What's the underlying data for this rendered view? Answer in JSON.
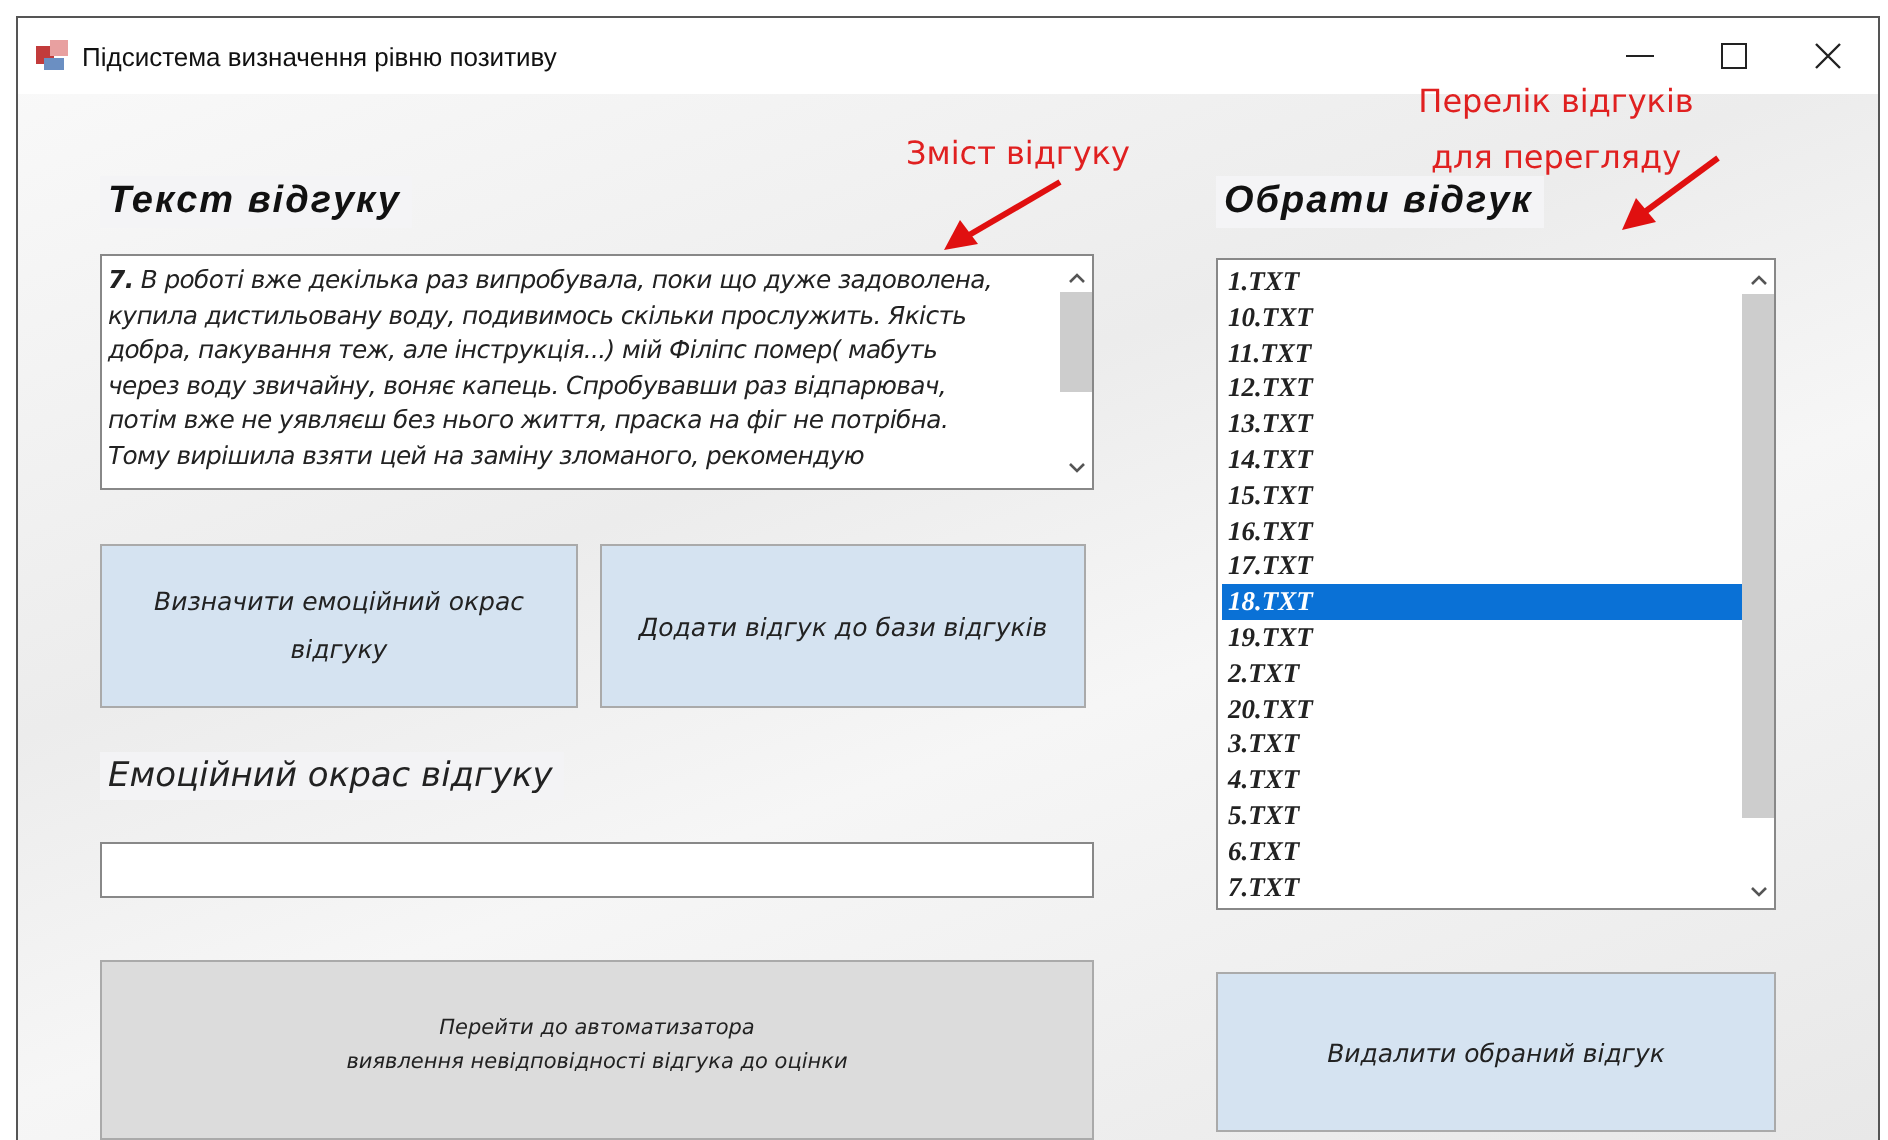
{
  "window": {
    "title": "Підсистема визначення рівню позитиву"
  },
  "review_heading": "Текст відгуку",
  "review_text": {
    "lines": [
      "**7.** В роботі вже декілька раз випробувала, поки що дуже задоволена,",
      "купила дистильовану воду, подивимось скільки прослужить. Якість",
      "добра, пакування теж, але інструкція...) мій Філіпс помер( мабуть",
      "через воду звичайну, воняє капець. Спробувавши раз відпарювач,",
      "потім вже не уявляєш без нього життя, праска на фіг не потрібна.",
      "Тому вирішила взяти цей на заміну зломаного, рекомендую"
    ]
  },
  "buttons": [
    {
      "label": "Визначити емоційний окрас відгуку"
    },
    {
      "label": "Додати відгук до бази відгуків"
    }
  ],
  "emotion_label": "Емоційний окрас відгуку",
  "navigate_button": {
    "lines": [
      "Перейти до автоматизатора",
      "виявлення невідповідності відгука до оцінки"
    ]
  },
  "list_heading": "Обрати відгук",
  "files": [
    {
      "name": "1.TXT",
      "selected": false
    },
    {
      "name": "10.TXT",
      "selected": false
    },
    {
      "name": "11.TXT",
      "selected": false
    },
    {
      "name": "12.TXT",
      "selected": false
    },
    {
      "name": "13.TXT",
      "selected": false
    },
    {
      "name": "14.TXT",
      "selected": false
    },
    {
      "name": "15.TXT",
      "selected": false
    },
    {
      "name": "16.TXT",
      "selected": false
    },
    {
      "name": "17.TXT",
      "selected": false
    },
    {
      "name": "18.TXT",
      "selected": true
    },
    {
      "name": "19.TXT",
      "selected": false
    },
    {
      "name": "2.TXT",
      "selected": false
    },
    {
      "name": "20.TXT",
      "selected": false
    },
    {
      "name": "3.TXT",
      "selected": false
    },
    {
      "name": "4.TXT",
      "selected": false
    },
    {
      "name": "5.TXT",
      "selected": false
    },
    {
      "name": "6.TXT",
      "selected": false
    },
    {
      "name": "7.TXT",
      "selected": false
    }
  ],
  "delete_button": "Видалити обраний відгук",
  "annotations": [
    {
      "text": "Зміст відгуку"
    },
    {
      "text": "Перелік відгуків для перегляду"
    }
  ]
}
